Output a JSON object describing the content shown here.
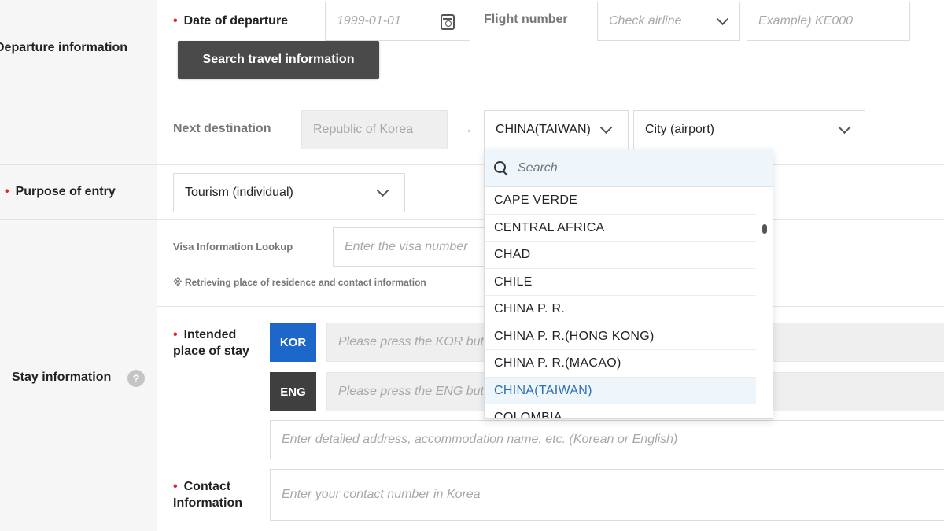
{
  "departure": {
    "section_label": "Departure information",
    "date_label": "Date of departure",
    "date_placeholder": "1999-01-01",
    "flight_label": "Flight number",
    "airline_placeholder": "Check airline",
    "flight_placeholder": "Example) KE000",
    "search_button": "Search travel information"
  },
  "destination": {
    "label": "Next destination",
    "from_value": "Republic of Korea",
    "arrow": "→",
    "country_value": "CHINA(TAIWAN)",
    "city_value": "City (airport)"
  },
  "purpose": {
    "label": "Purpose of entry",
    "value": "Tourism (individual)"
  },
  "visa": {
    "label": "Visa Information Lookup",
    "placeholder": "Enter the visa number",
    "note": "※ Retrieving place of residence and contact information"
  },
  "stay": {
    "section_label": "Stay information",
    "help": "?",
    "place_label_1": "Intended",
    "place_label_2": "place of stay",
    "kor_tag": "KOR",
    "kor_placeholder": "Please press the KOR button",
    "eng_tag": "ENG",
    "eng_placeholder": "Please press the ENG button",
    "address_placeholder": "Enter detailed address, accommodation name, etc. (Korean or English)",
    "contact_label_1": "Contact",
    "contact_label_2": "Information",
    "contact_placeholder": "Enter your contact number in Korea"
  },
  "dropdown": {
    "search_placeholder": "Search",
    "items": [
      "CAPE VERDE",
      "CENTRAL AFRICA",
      "CHAD",
      "CHILE",
      "CHINA P. R.",
      "CHINA P. R.(HONG KONG)",
      "CHINA P. R.(MACAO)",
      "CHINA(TAIWAN)",
      "COLOMBIA"
    ]
  },
  "required_mark": "•",
  "colors": {
    "required": "#d9232e",
    "kor_blue": "#1c67c9",
    "selected_text": "#2a6fb5"
  }
}
